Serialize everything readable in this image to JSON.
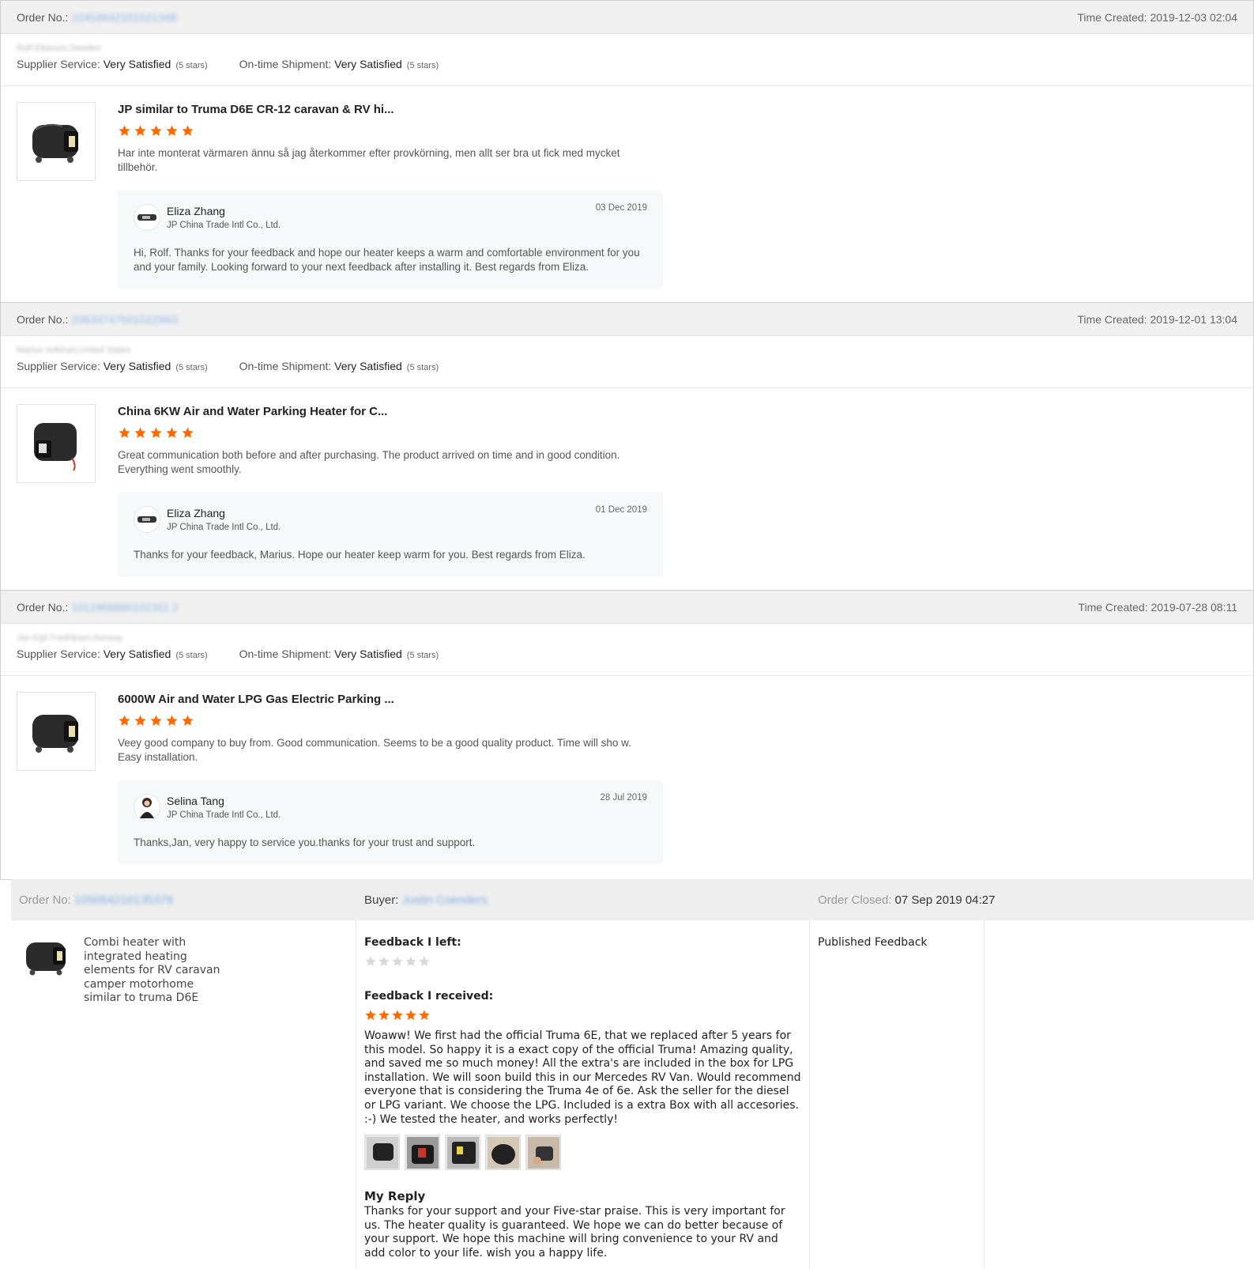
{
  "star_color": "#ff6a00",
  "orders": [
    {
      "order_label": "Order No.:",
      "order_no": "2245484233102134B",
      "time_created": "Time Created: 2019-12-03 02:04",
      "buyer": "Rolf Eliasson,Sweden",
      "supplier_label": "Supplier Service:",
      "supplier_value": "Very Satisfied",
      "supplier_stars": "(5 stars)",
      "shipment_label": "On-time Shipment:",
      "shipment_value": "Very Satisfied",
      "shipment_stars": "(5 stars)",
      "product_title": "JP similar to Truma D6E CR-12 caravan & RV hi...",
      "rating": 5,
      "review": "Har inte monterat värmaren ännu så jag återkommer efter provkörning, men allt ser bra ut fick med mycket tillbehör.",
      "reply_name": "Eliza Zhang",
      "reply_company": "JP China Trade Intl Co., Ltd.",
      "reply_date": "03 Dec 2019",
      "reply_text": "Hi, Rolf. Thanks for your feedback and hope our heater keeps a warm and comfortable environment for you and your family. Looking forward to your next feedback after installing it. Best regards from Eliza."
    },
    {
      "order_label": "Order No.:",
      "order_no": "2063374750102296G",
      "time_created": "Time Created: 2019-12-01 13:04",
      "buyer": "Marius Volkhart,United States",
      "supplier_label": "Supplier Service:",
      "supplier_value": "Very Satisfied",
      "supplier_stars": "(5 stars)",
      "shipment_label": "On-time Shipment:",
      "shipment_value": "Very Satisfied",
      "shipment_stars": "(5 stars)",
      "product_title": "China 6KW Air and Water Parking Heater for C...",
      "rating": 5,
      "review": "Great communication both before and after purchasing. The product arrived on time and in good condition. Everything went smoothly.",
      "reply_name": "Eliza Zhang",
      "reply_company": "JP China Trade Intl Co., Ltd.",
      "reply_date": "01 Dec 2019",
      "reply_text": "Thanks for your feedback, Marius. Hope our heater keep warm for you. Best regards from Eliza."
    },
    {
      "order_label": "Order No.:",
      "order_no": "1012968880102311 2",
      "time_created": "Time Created: 2019-07-28 08:11",
      "buyer": "Jan Egil Fredriksen,Norway",
      "supplier_label": "Supplier Service:",
      "supplier_value": "Very Satisfied",
      "supplier_stars": "(5 stars)",
      "shipment_label": "On-time Shipment:",
      "shipment_value": "Very Satisfied",
      "shipment_stars": "(5 stars)",
      "product_title": "6000W Air and Water LPG Gas Electric Parking ...",
      "rating": 5,
      "review": "Veey good company to buy from. Good communication. Seems to be a good quality product. Time will sho w. Easy installation.",
      "reply_name": "Selina Tang",
      "reply_company": "JP China Trade Intl Co., Ltd.",
      "reply_date": "28 Jul 2019",
      "reply_text": "Thanks,Jan, very happy to service you.thanks for your trust and support."
    }
  ],
  "legacy": {
    "order_label": "Order No:",
    "order_no": "105064216135376",
    "buyer_label": "Buyer:",
    "buyer_name": "Justin Coenders",
    "closed_label": "Order Closed:",
    "closed_value": "07 Sep 2019 04:27",
    "product_name": "Combi heater with integrated heating elements for RV caravan camper motorhome similar to truma D6E",
    "feedback_left_label": "Feedback I left:",
    "feedback_left_rating": 0,
    "feedback_received_label": "Feedback I received:",
    "feedback_received_rating": 5,
    "received_text": "Woaww! We first had the official Truma 6E, that we replaced after 5 years for this model. So happy it is a exact copy of the official Truma! Amazing quality, and saved me so much money! All the extra's are included in the box for LPG installation. We will soon build this in our Mercedes RV Van. Would recommend everyone that is considering the Truma 4e of 6e. Ask the seller for the diesel or LPG variant. We choose the LPG. Included is a extra Box with all accesories. :-) We tested the heater, and works perfectly!",
    "my_reply_label": "My Reply",
    "my_reply_text": "Thanks for your support and your Five-star praise. This is very important for us. The heater quality is guaranteed. We hope we can do better because of your support. We hope this machine will bring convenience to your RV and add color to your life. wish you a happy life.",
    "status": "Published Feedback",
    "photo_count": 5
  }
}
